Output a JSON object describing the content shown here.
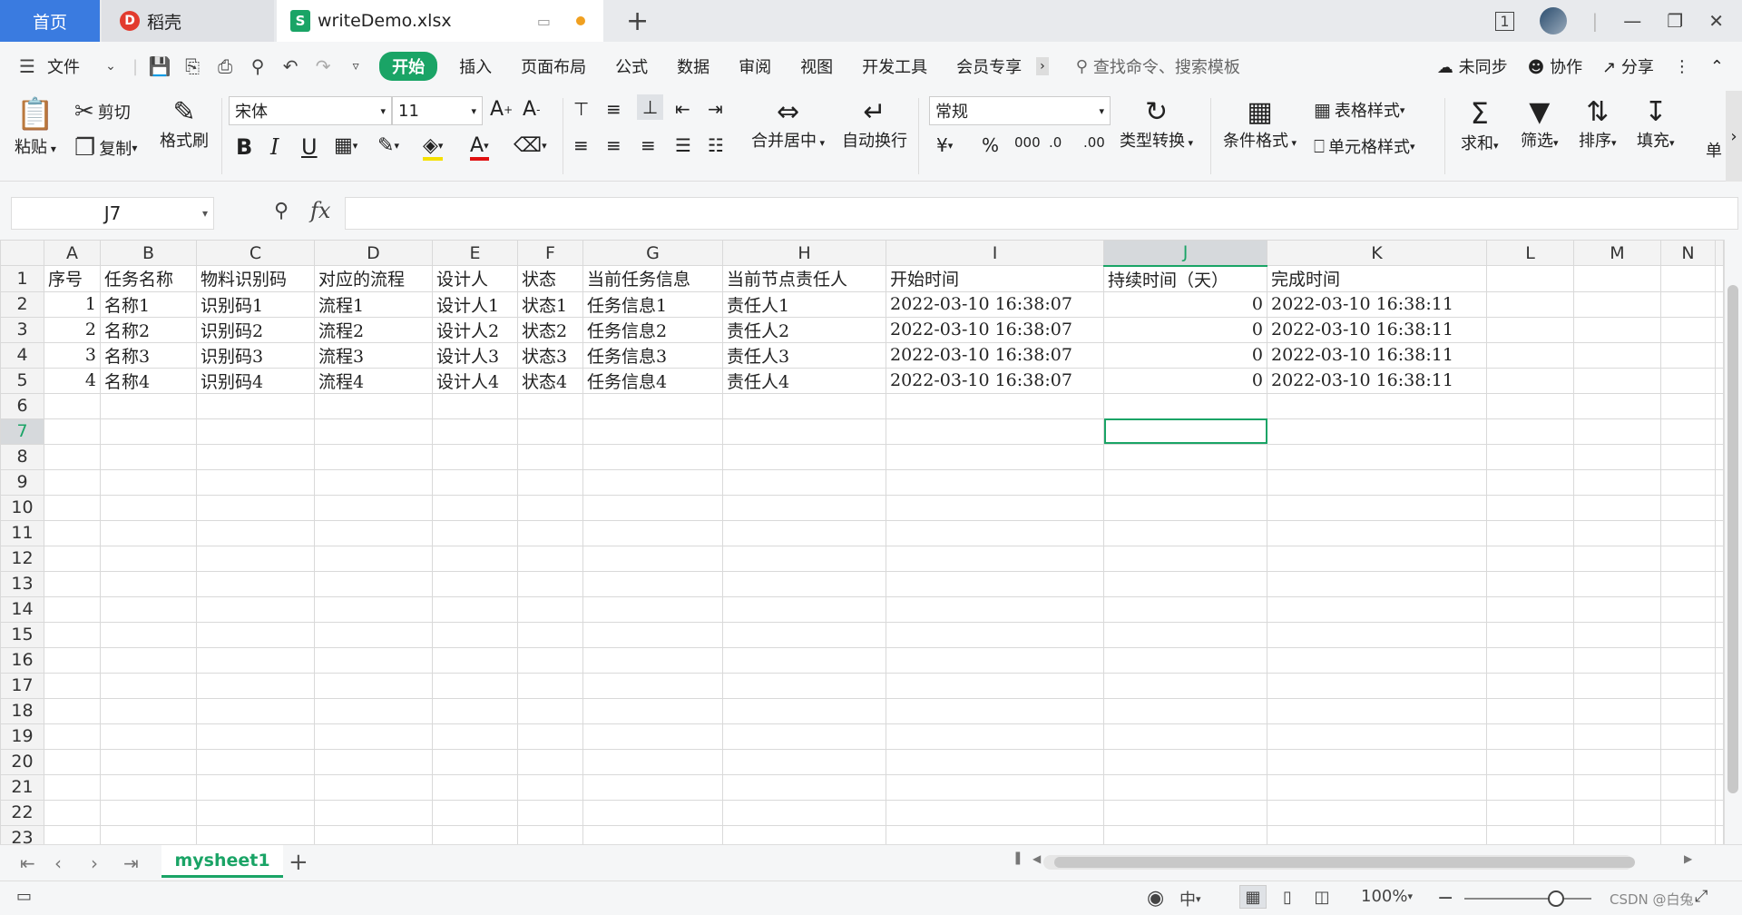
{
  "titlebar": {
    "home_tab": "首页",
    "docer_tab": "稻壳",
    "file_tab": "writeDemo.xlsx",
    "file_icon_letter": "S",
    "new_tab": "+",
    "docer_icon_letter": "D"
  },
  "menu": {
    "file": "文件",
    "tabs": [
      "开始",
      "插入",
      "页面布局",
      "公式",
      "数据",
      "审阅",
      "视图",
      "开发工具",
      "会员专享"
    ],
    "search_placeholder": "查找命令、搜索模板",
    "sync": "未同步",
    "collab": "协作",
    "share": "分享"
  },
  "ribbon": {
    "paste": "粘贴",
    "cut": "剪切",
    "copy": "复制",
    "format_painter": "格式刷",
    "font_name": "宋体",
    "font_size": "11",
    "merge_center": "合并居中",
    "auto_wrap": "自动换行",
    "number_format": "常规",
    "type_convert": "类型转换",
    "cond_format": "条件格式",
    "table_style": "表格样式",
    "cell_style": "单元格样式",
    "sum": "求和",
    "filter": "筛选",
    "sort": "排序",
    "fill": "填充",
    "more": "单"
  },
  "formula": {
    "name_box": "J7",
    "fx": "fx",
    "value": ""
  },
  "sheet": {
    "columns": [
      "A",
      "B",
      "C",
      "D",
      "E",
      "F",
      "G",
      "H",
      "I",
      "J",
      "K",
      "L",
      "M",
      "N"
    ],
    "rows": [
      [
        "序号",
        "任务名称",
        "物料识别码",
        "对应的流程",
        "设计人",
        "状态",
        "当前任务信息",
        "当前节点责任人",
        "开始时间",
        "持续时间（天）",
        "完成时间",
        "",
        "",
        ""
      ],
      [
        "1",
        "名称1",
        "识别码1",
        "流程1",
        "设计人1",
        "状态1",
        "任务信息1",
        "责任人1",
        "2022-03-10  16:38:07",
        "0",
        "2022-03-10  16:38:11",
        "",
        "",
        ""
      ],
      [
        "2",
        "名称2",
        "识别码2",
        "流程2",
        "设计人2",
        "状态2",
        "任务信息2",
        "责任人2",
        "2022-03-10  16:38:07",
        "0",
        "2022-03-10  16:38:11",
        "",
        "",
        ""
      ],
      [
        "3",
        "名称3",
        "识别码3",
        "流程3",
        "设计人3",
        "状态3",
        "任务信息3",
        "责任人3",
        "2022-03-10  16:38:07",
        "0",
        "2022-03-10  16:38:11",
        "",
        "",
        ""
      ],
      [
        "4",
        "名称4",
        "识别码4",
        "流程4",
        "设计人4",
        "状态4",
        "任务信息4",
        "责任人4",
        "2022-03-10  16:38:07",
        "0",
        "2022-03-10  16:38:11",
        "",
        "",
        ""
      ]
    ],
    "row_count": 23,
    "active_cell": "J7",
    "tab_name": "mysheet1"
  },
  "statusbar": {
    "zoom": "100%",
    "watermark": "CSDN @白兔"
  },
  "colors": {
    "accent": "#1aa466",
    "home_tab": "#3a7be0"
  }
}
